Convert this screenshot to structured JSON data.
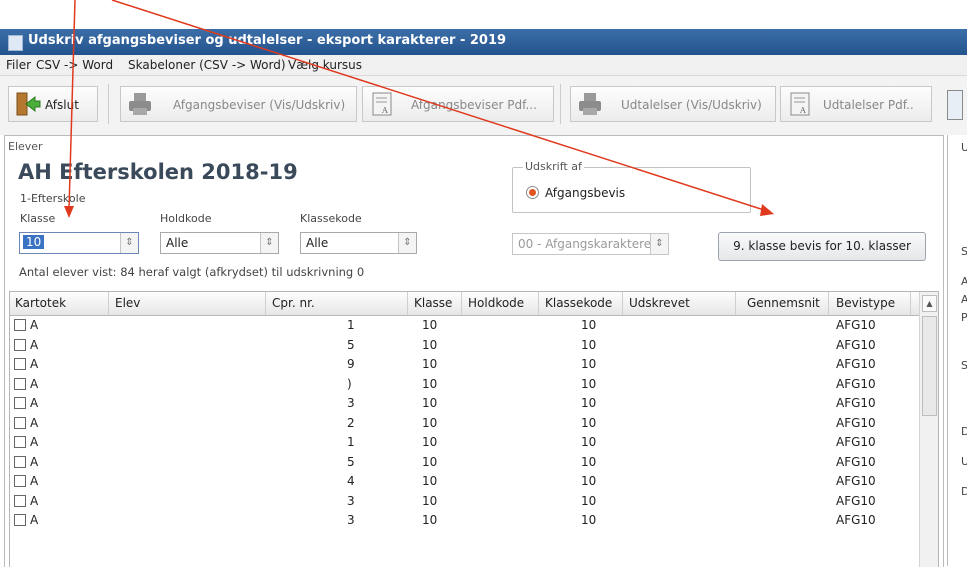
{
  "window": {
    "title": "Udskriv afgangsbeviser og udtalelser - eksport karakterer - 2019"
  },
  "menu": [
    "Filer",
    "CSV -> Word",
    "Skabeloner (CSV -> Word)",
    "Vælg kursus"
  ],
  "toolbar": {
    "exit": "Afslut",
    "cert_print": "Afgangsbeviser (Vis/Udskriv)",
    "cert_pdf": "Afgangsbeviser Pdf...",
    "statement_print": "Udtalelser (Vis/Udskriv)",
    "statement_pdf": "Udtalelser Pdf.."
  },
  "students": {
    "group_title": "Elever",
    "school": "AH Efterskolen 2018-19",
    "school_sub": "1-Efterskole",
    "klasse_label": "Klasse",
    "klasse_value": "10",
    "holdkode_label": "Holdkode",
    "holdkode_value": "Alle",
    "klassekode_label": "Klassekode",
    "klassekode_value": "Alle",
    "count_text": "Antal elever vist: 84 heraf valgt (afkrydset) til udskrivning 0"
  },
  "print": {
    "group_title": "Udskrift af",
    "option": "Afgangsbevis",
    "grades_select": "00 - Afgangskarakterer",
    "button9": "9. klasse bevis for 10. klasser"
  },
  "table": {
    "columns": [
      "Kartotek",
      "Elev",
      "Cpr. nr.",
      "Klasse",
      "Holdkode",
      "Klassekode",
      "Udskrevet",
      "Gennemsnit",
      "Bevistype"
    ],
    "rows": [
      {
        "kartotek": "A",
        "cpr": "1",
        "klasse": "10",
        "klassekode": "10",
        "bevistype": "AFG10"
      },
      {
        "kartotek": "A",
        "cpr": "5",
        "klasse": "10",
        "klassekode": "10",
        "bevistype": "AFG10"
      },
      {
        "kartotek": "A",
        "cpr": "9",
        "klasse": "10",
        "klassekode": "10",
        "bevistype": "AFG10"
      },
      {
        "kartotek": "A",
        "cpr": ")",
        "klasse": "10",
        "klassekode": "10",
        "bevistype": "AFG10"
      },
      {
        "kartotek": "A",
        "cpr": "3",
        "klasse": "10",
        "klassekode": "10",
        "bevistype": "AFG10"
      },
      {
        "kartotek": "A",
        "cpr": "2",
        "klasse": "10",
        "klassekode": "10",
        "bevistype": "AFG10"
      },
      {
        "kartotek": "A",
        "cpr": "1",
        "klasse": "10",
        "klassekode": "10",
        "bevistype": "AFG10"
      },
      {
        "kartotek": "A",
        "cpr": "5",
        "klasse": "10",
        "klassekode": "10",
        "bevistype": "AFG10"
      },
      {
        "kartotek": "A",
        "cpr": "4",
        "klasse": "10",
        "klassekode": "10",
        "bevistype": "AFG10"
      },
      {
        "kartotek": "A",
        "cpr": "3",
        "klasse": "10",
        "klassekode": "10",
        "bevistype": "AFG10"
      },
      {
        "kartotek": "A",
        "cpr": "3",
        "klasse": "10",
        "klassekode": "10",
        "bevistype": "AFG10"
      }
    ]
  },
  "right_panel": {
    "letters": [
      "U",
      "S",
      "A",
      "A",
      "P",
      "S",
      "D",
      "U",
      "D"
    ]
  },
  "colors": {
    "titlebar": "#2b5b95",
    "annotation_arrow": "#e03a1e",
    "radio": "#e0541f"
  }
}
